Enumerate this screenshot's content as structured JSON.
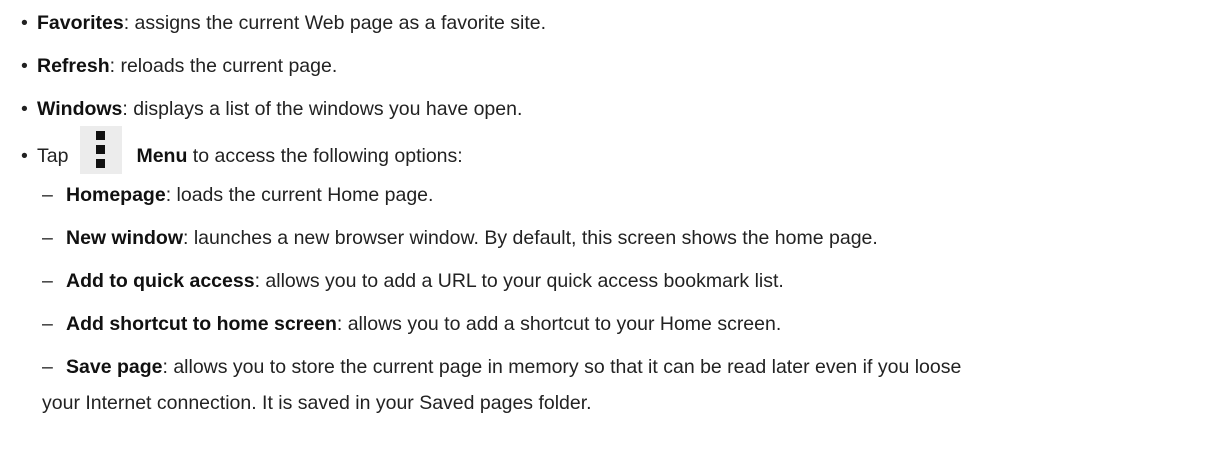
{
  "items": [
    {
      "bullet": "•",
      "term": "Favorites",
      "text": ": assigns the current Web page as a favorite site."
    },
    {
      "bullet": "•",
      "term": "Refresh",
      "text": ": reloads the current page."
    },
    {
      "bullet": "•",
      "term": "Windows",
      "text": ": displays a list of the windows you have open."
    }
  ],
  "menu_line": {
    "bullet": "•",
    "prefix": "Tap",
    "icon": "menu-kebab-icon",
    "term": "Menu",
    "text": " to access the following options:"
  },
  "sub_items": [
    {
      "dash": "–",
      "term": "Homepage",
      "text": ": loads the current Home page."
    },
    {
      "dash": "–",
      "term": "New window",
      "text": ": launches a new browser window. By default, this screen shows the home page."
    },
    {
      "dash": "–",
      "term": "Add to quick access",
      "text": ": allows you to add a URL to your quick access bookmark list."
    },
    {
      "dash": "–",
      "term": "Add shortcut to home screen",
      "text": ": allows you to add a shortcut to your Home screen."
    },
    {
      "dash": "–",
      "term": "Save page",
      "text": ": allows you to store the current page in memory so that it can be read later even if you loose",
      "continuation": "your Internet connection. It is saved in your Saved pages folder."
    }
  ]
}
